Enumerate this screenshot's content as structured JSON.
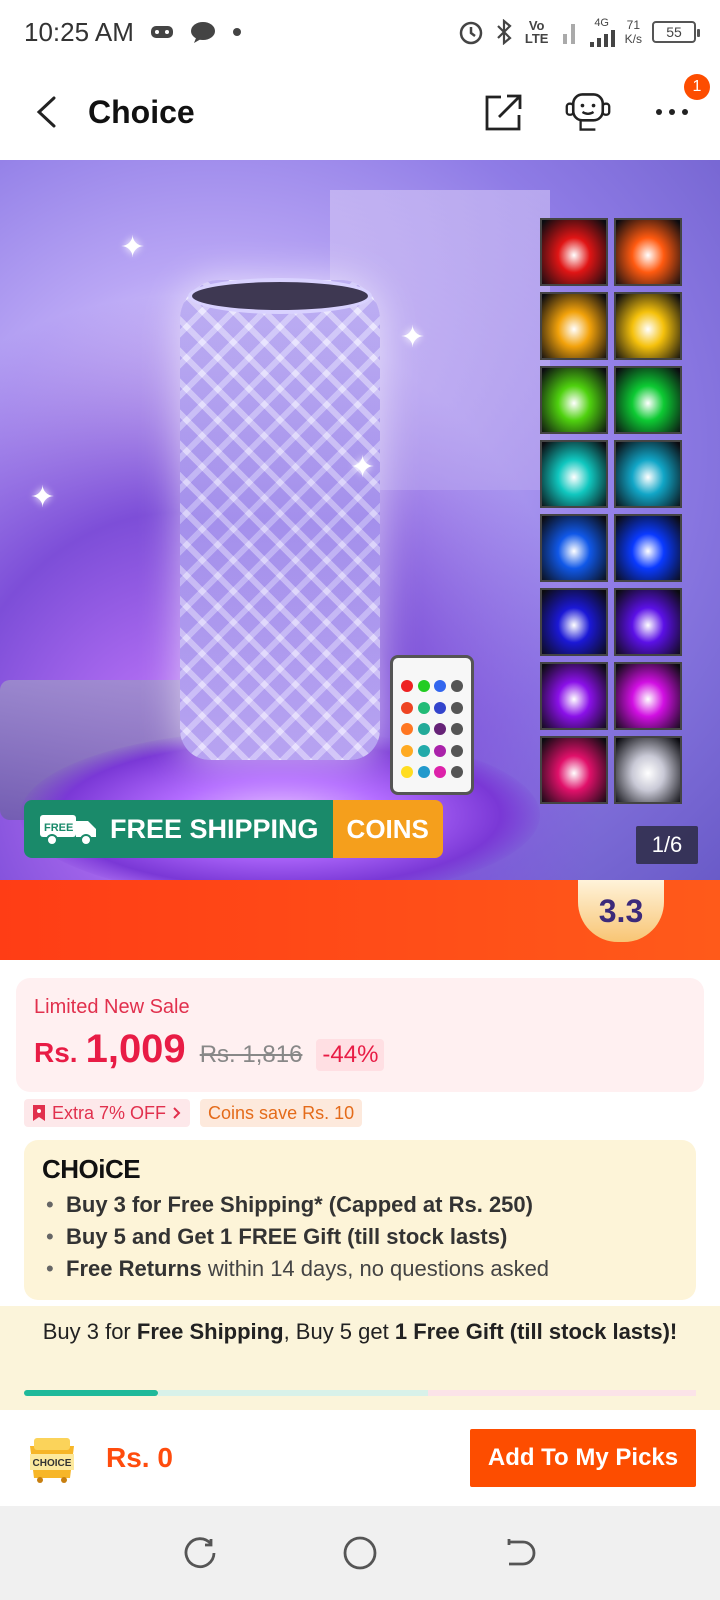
{
  "status_bar": {
    "time": "10:25 AM",
    "network_label": "4G",
    "volte_label": "Vo LTE",
    "speed_value": "71",
    "speed_unit": "K/s",
    "battery": "55"
  },
  "header": {
    "title": "Choice",
    "cart_badge": "1"
  },
  "hero": {
    "shipping_label": "FREE SHIPPING",
    "free_tag": "FREE",
    "coins_label": "COINS",
    "image_counter": "1/6",
    "swatch_colors": [
      "#e01515",
      "#ff5a10",
      "#f2a20b",
      "#f5c10c",
      "#4fd10f",
      "#0dca33",
      "#10c7bf",
      "#11a6c7",
      "#1058e8",
      "#0a3aff",
      "#1b18d6",
      "#5b10e6",
      "#8a10e8",
      "#d10fe2",
      "#e0106a",
      "#c9c9d6"
    ]
  },
  "promo": {
    "badge": "3.3"
  },
  "price": {
    "sale_label": "Limited New Sale",
    "currency": "Rs.",
    "current": "1,009",
    "original": "Rs. 1,816",
    "discount": "-44%"
  },
  "tags": {
    "extra_off": "Extra 7% OFF",
    "coins_save": "Coins save Rs. 10"
  },
  "choice": {
    "logo": "CHOiCE",
    "items": [
      {
        "bold": "Buy 3 for  Free Shipping* (Capped at Rs. 250)",
        "rest": ""
      },
      {
        "bold": "Buy 5 and Get 1 FREE Gift (till stock lasts)",
        "rest": ""
      },
      {
        "bold": "Free Returns",
        "rest": " within 14 days, no questions asked"
      }
    ]
  },
  "buy_bar": {
    "part1": "Buy 3 for ",
    "part2": "Free Shipping",
    "part3": ", Buy 5 get ",
    "part4": "1 Free Gift (till stock lasts)!",
    "progress_fraction": 0.2
  },
  "bottom": {
    "cart_total": "Rs. 0",
    "cart_label": "CHOICE",
    "add_button": "Add To My Picks"
  },
  "colors": {
    "accent": "#fd4d00",
    "price": "#e81c45",
    "shipping_green": "#1a8a6a",
    "coins_orange": "#f59f1c"
  }
}
